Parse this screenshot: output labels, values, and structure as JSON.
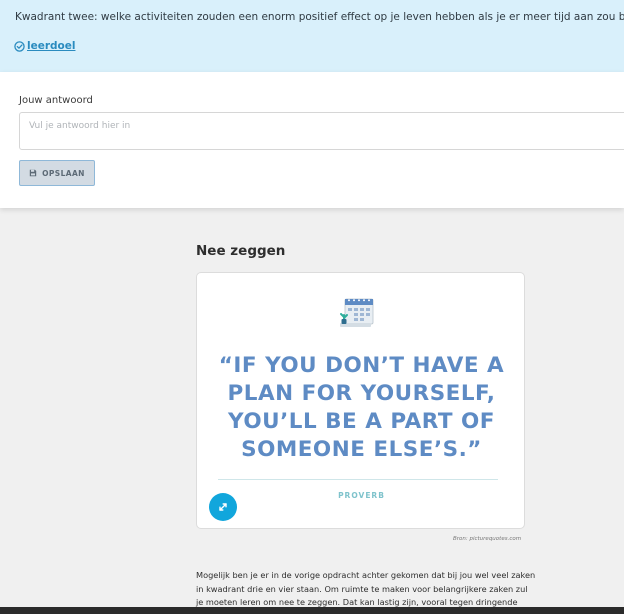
{
  "question": {
    "text": "Kwadrant twee: welke activiteiten zouden een enorm positief effect op je leven hebben als je er meer tijd aan zou besteden? Neem de belangrijkste op",
    "leerdoel_label": "leerdoel"
  },
  "answer": {
    "label": "Jouw antwoord",
    "placeholder": "Vul je antwoord hier in",
    "value": "",
    "save_label": "OPSLAAN"
  },
  "section": {
    "title": "Nee zeggen"
  },
  "quote_card": {
    "lines": [
      "“IF YOU DON’T HAVE A",
      "PLAN FOR YOURSELF,",
      "YOU’LL BE A PART OF",
      "SOMEONE ELSE’S.”"
    ],
    "source": "PROVERB",
    "credit": "Bron: picturequotes.com",
    "quote_color": "#5e8bc4",
    "accent_color": "#11a6dc"
  },
  "body": {
    "paragraph": "Mogelijk ben je er in de vorige opdracht achter gekomen dat bij jou wel veel zaken in kwadrant drie en vier staan. Om ruimte te maken voor belangrijkere zaken zul je moeten leren om nee te zeggen. Dat kan lastig zijn, vooral tegen dringende zaken."
  },
  "icons": {
    "leerdoel": "target-check-icon",
    "save": "floppy-disk-icon",
    "expand": "expand-arrows-icon",
    "calendar": "calendar-illustration"
  },
  "colors": {
    "banner_bg": "#d9f0fb",
    "link": "#2a8bbf",
    "page_bg": "#f0f0f0"
  }
}
